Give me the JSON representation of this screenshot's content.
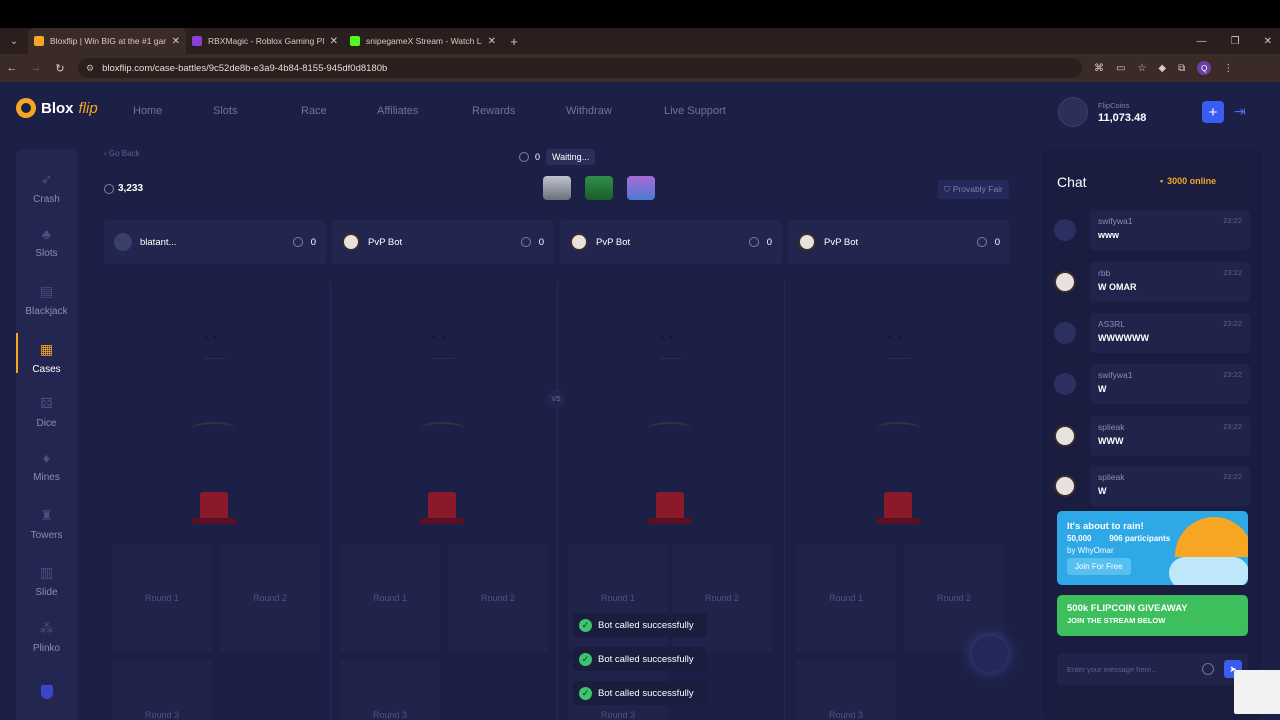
{
  "browser": {
    "tabs": [
      {
        "title": "Bloxflip | Win BIG at the #1 gam",
        "color": "#f6a623",
        "active": true
      },
      {
        "title": "RBXMagic - Roblox Gaming Pla",
        "color": "#8b3fd6",
        "active": false
      },
      {
        "title": "snipegameX Stream - Watch Li",
        "color": "#53fc18",
        "active": false
      }
    ],
    "url": "bloxflip.com/case-battles/9c52de8b-e3a9-4b84-8155-945df0d8180b",
    "profile_initial": "Q"
  },
  "site": {
    "logo_main": "Blox",
    "logo_accent": "flip",
    "nav": [
      "Home",
      "Slots",
      "Race",
      "Affiliates",
      "Rewards",
      "Withdraw",
      "Live Support"
    ],
    "balance_label": "FlipCoins",
    "balance_value": "11,073.48",
    "accent_color": "#f6a623",
    "primary_button_color": "#3a5cf0"
  },
  "sidebar": {
    "items": [
      {
        "label": "Crash",
        "icon": "rocket-icon"
      },
      {
        "label": "Slots",
        "icon": "slots-icon"
      },
      {
        "label": "Blackjack",
        "icon": "cards-icon"
      },
      {
        "label": "Cases",
        "icon": "chest-icon",
        "active": true
      },
      {
        "label": "Dice",
        "icon": "dice-icon"
      },
      {
        "label": "Mines",
        "icon": "gem-icon"
      },
      {
        "label": "Towers",
        "icon": "tower-icon"
      },
      {
        "label": "Slide",
        "icon": "slide-icon"
      },
      {
        "label": "Plinko",
        "icon": "plinko-icon"
      }
    ]
  },
  "battle": {
    "go_back": "‹ Go Back",
    "total_value": "3,233",
    "round_value": "0",
    "status": "Waiting...",
    "provably_fair": "Provably Fair",
    "players": [
      {
        "name": "blatant...",
        "value": "0",
        "bot": false
      },
      {
        "name": "PvP Bot",
        "value": "0",
        "bot": true
      },
      {
        "name": "PvP Bot",
        "value": "0",
        "bot": true
      },
      {
        "name": "PvP Bot",
        "value": "0",
        "bot": true
      }
    ],
    "vs_label": "VS",
    "rounds": [
      "Round 1",
      "Round 2",
      "Round 3"
    ],
    "toasts": [
      "Bot called successfully",
      "Bot called successfully",
      "Bot called successfully"
    ]
  },
  "chat": {
    "title": "Chat",
    "online": "3000 online",
    "messages": [
      {
        "user": "swifywa1",
        "text": "www",
        "time": "23:22",
        "bot_avatar": false
      },
      {
        "user": "rbb",
        "text": "W OMAR",
        "time": "23:22",
        "bot_avatar": true
      },
      {
        "user": "AS3RL",
        "text": "WWWWWW",
        "time": "23:22",
        "bot_avatar": false
      },
      {
        "user": "swifywa1",
        "text": "W",
        "time": "23:22",
        "bot_avatar": false
      },
      {
        "user": "splieak",
        "text": "WWW",
        "time": "23:22",
        "bot_avatar": true
      },
      {
        "user": "splieak",
        "text": "W",
        "time": "23:22",
        "bot_avatar": true
      }
    ],
    "rain": {
      "title": "It's about to rain!",
      "amount": "50,000",
      "participants": "906 participants",
      "by": "by WhyOmar",
      "join": "Join For Free"
    },
    "giveaway": {
      "title": "500k FLIPCOIN GIVEAWAY",
      "subtitle": "JOIN THE STREAM BELOW"
    },
    "input_placeholder": "Enter your message here..."
  }
}
